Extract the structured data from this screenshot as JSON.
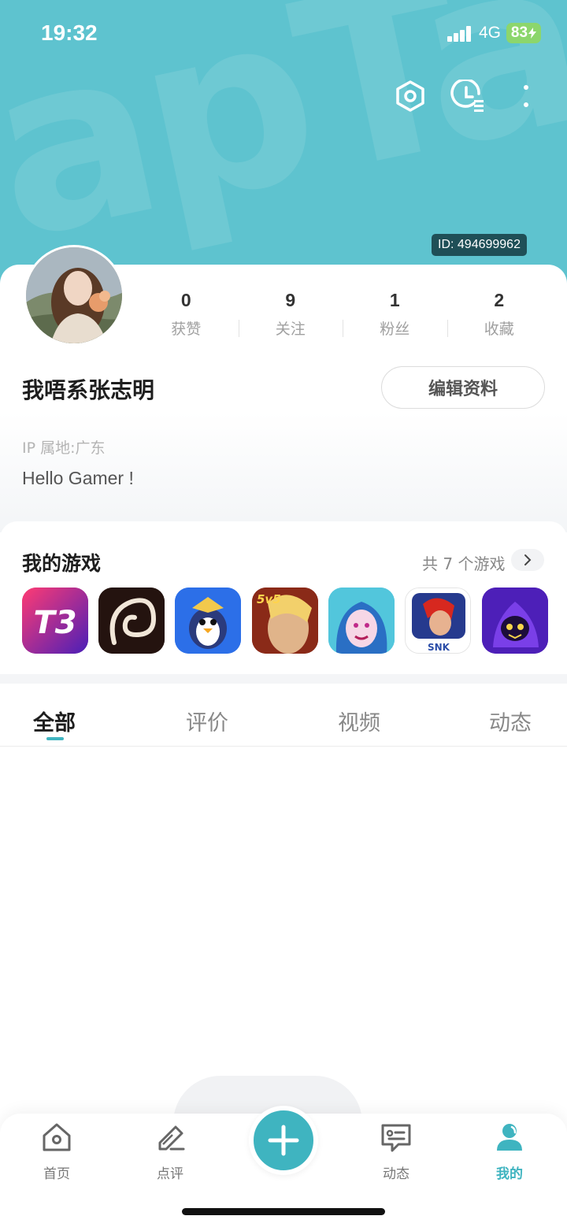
{
  "status_bar": {
    "time": "19:32",
    "network": "4G",
    "battery": "83"
  },
  "header": {
    "watermark": "apTap",
    "user_id": "ID: 494699962"
  },
  "profile": {
    "stats": [
      {
        "value": "0",
        "label": "获赞"
      },
      {
        "value": "9",
        "label": "关注"
      },
      {
        "value": "1",
        "label": "粉丝"
      },
      {
        "value": "2",
        "label": "收藏"
      }
    ],
    "username": "我唔系张志明",
    "edit_label": "编辑资料",
    "ip_location": "IP 属地:广东",
    "bio": "Hello Gamer !"
  },
  "games": {
    "title": "我的游戏",
    "count_label": "共 7 个游戏",
    "items": [
      {
        "icon_text": "T3",
        "tag": ""
      },
      {
        "icon_text": "",
        "tag": ""
      },
      {
        "icon_text": "",
        "tag": ""
      },
      {
        "icon_text": "",
        "tag": "5v5"
      },
      {
        "icon_text": "",
        "tag": ""
      },
      {
        "icon_text": "",
        "tag": "SNK"
      },
      {
        "icon_text": "",
        "tag": ""
      }
    ]
  },
  "tabs": [
    {
      "label": "全部"
    },
    {
      "label": "评价"
    },
    {
      "label": "视频"
    },
    {
      "label": "动态"
    }
  ],
  "bottom_nav": [
    {
      "label": "首页",
      "icon": "home-icon"
    },
    {
      "label": "点评",
      "icon": "edit-icon"
    },
    {
      "label": "动态",
      "icon": "message-icon"
    },
    {
      "label": "我的",
      "icon": "user-icon"
    }
  ],
  "colors": {
    "accent": "#3fb4c0",
    "banner": "#5ec3cf",
    "battery": "#8cd66c"
  }
}
